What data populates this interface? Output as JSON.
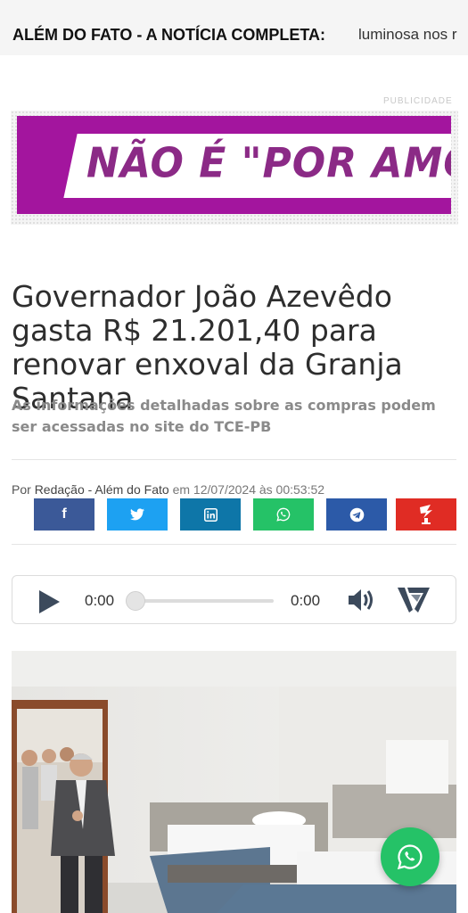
{
  "ticker": {
    "label": "ALÉM DO FATO - A NOTÍCIA COMPLETA:",
    "text": "luminosa nos r"
  },
  "ad": {
    "label": "PUBLICIDADE",
    "banner_text": "NÃO É \"POR AMOR\", É C",
    "colors": {
      "background": "#a3159e",
      "text": "#8b2a86"
    }
  },
  "article": {
    "headline": "Governador João Azevêdo gasta R$ 21.201,40 para renovar enxoval da Granja Santana",
    "subtitle": "As informações detalhadas sobre as compras podem ser acessadas no site do TCE-PB",
    "byline": {
      "prefix": "Por",
      "author": "Redação - Além do Fato",
      "date_prefix": "em",
      "date": "12/07/2024 às 00:53:52"
    }
  },
  "share": {
    "buttons": [
      {
        "name": "share-facebook-button",
        "icon": "facebook-icon",
        "color": "#3b5998"
      },
      {
        "name": "share-twitter-button",
        "icon": "twitter-icon",
        "color": "#1da1f2"
      },
      {
        "name": "share-linkedin-button",
        "icon": "linkedin-icon",
        "color": "#0e76a8"
      },
      {
        "name": "share-whatsapp-button",
        "icon": "whatsapp-icon",
        "color": "#25c267"
      },
      {
        "name": "share-telegram-button",
        "icon": "telegram-icon",
        "color": "#2c5aa8"
      },
      {
        "name": "share-flipboard-button",
        "icon": "flipboard-icon",
        "color": "#e02c24"
      }
    ]
  },
  "audio_player": {
    "current_time": "0:00",
    "duration": "0:00",
    "progress": 0
  },
  "whatsapp_float": {
    "icon": "whatsapp-icon",
    "color": "#25c267"
  }
}
